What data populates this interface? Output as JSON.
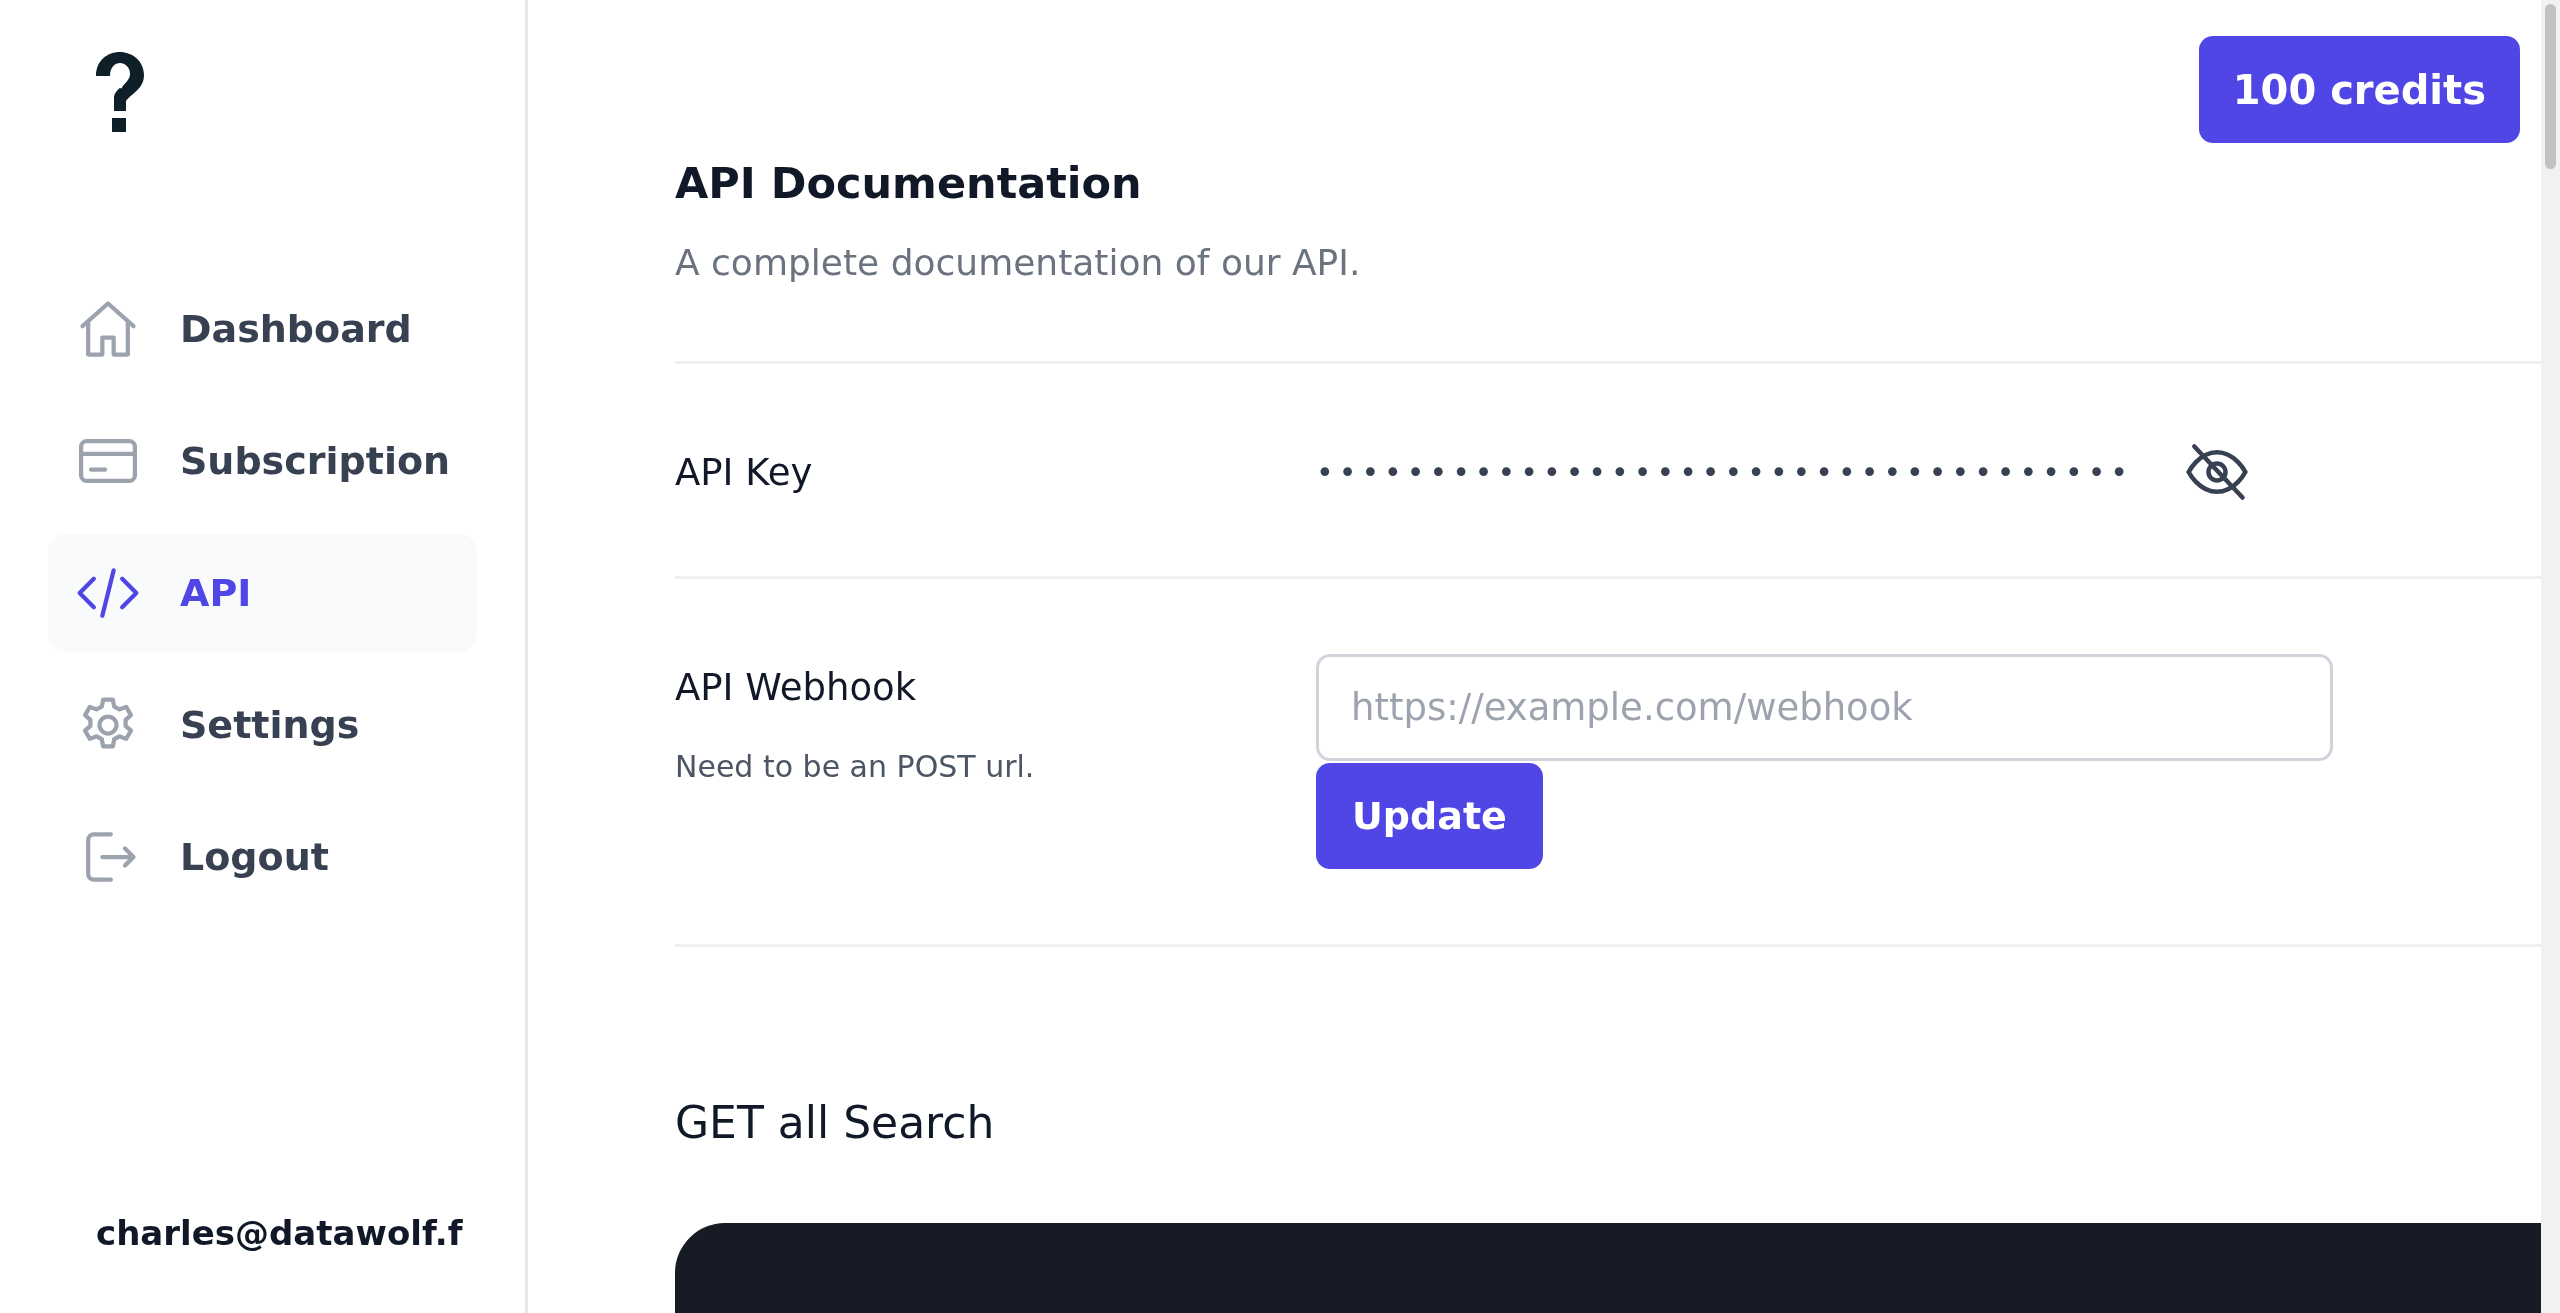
{
  "credits": "100 credits",
  "sidebar": {
    "items": [
      {
        "label": "Dashboard",
        "selected": false
      },
      {
        "label": "Subscription",
        "selected": false
      },
      {
        "label": "API",
        "selected": true
      },
      {
        "label": "Settings",
        "selected": false
      },
      {
        "label": "Logout",
        "selected": false
      }
    ],
    "user_email": "charles@datawolf.f"
  },
  "header": {
    "title": "API Documentation",
    "subtitle": "A complete documentation of our API."
  },
  "api_key": {
    "label": "API Key",
    "value": "••••••••••••••••••••••••••••••••••••",
    "revealed": false
  },
  "webhook": {
    "label": "API Webhook",
    "hint": "Need to be an POST url.",
    "placeholder": "https://example.com/webhook",
    "button": "Update"
  },
  "endpoints": [
    {
      "title": "GET all Search"
    }
  ]
}
